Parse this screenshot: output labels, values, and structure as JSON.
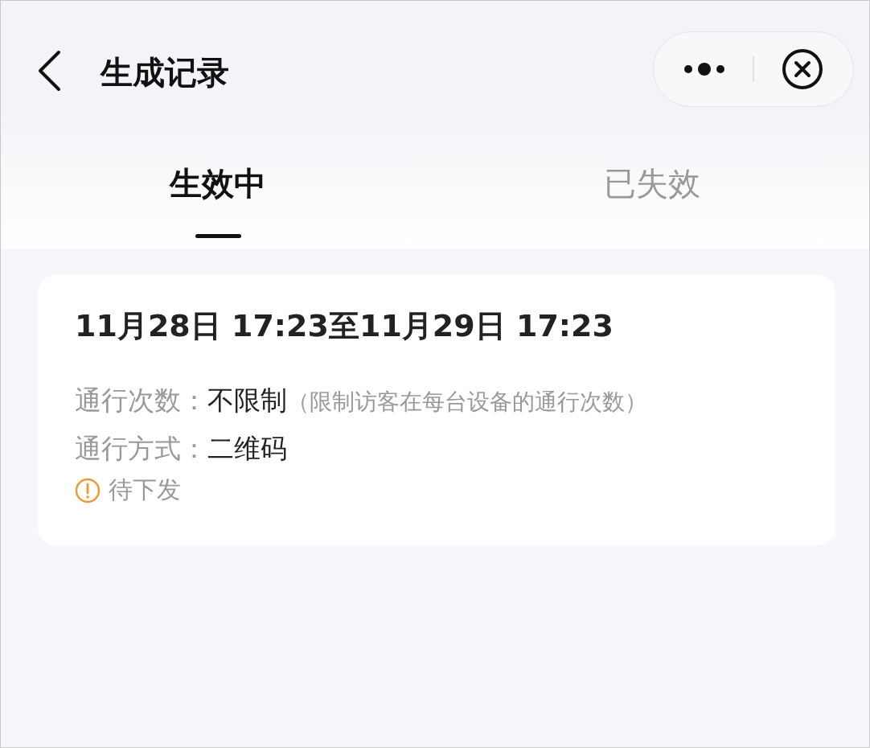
{
  "header": {
    "title": "生成记录"
  },
  "tabs": [
    {
      "label": "生效中",
      "selected": true
    },
    {
      "label": "已失效",
      "selected": false
    }
  ],
  "records": [
    {
      "period": "11月28日 17:23至11月29日 17:23",
      "fields": [
        {
          "label": "通行次数：",
          "value": "不限制",
          "note": "（限制访客在每台设备的通行次数）"
        },
        {
          "label": "通行方式：",
          "value": "二维码"
        }
      ],
      "status": "待下发"
    }
  ]
}
